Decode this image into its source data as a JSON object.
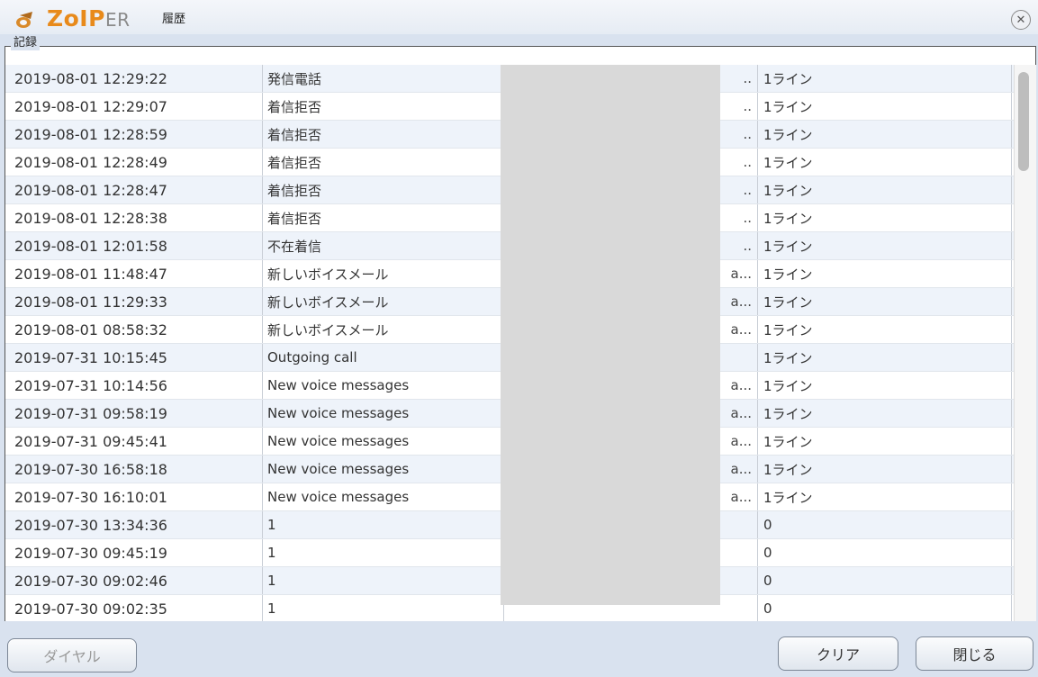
{
  "window": {
    "brand_main": "ZoIP",
    "brand_tail": "ER",
    "title": "履歴"
  },
  "group": {
    "label": "記録"
  },
  "rows": [
    {
      "time": "2019-08-01 12:29:22",
      "type": "発信電話",
      "num": "..",
      "line": "1ライン"
    },
    {
      "time": "2019-08-01 12:29:07",
      "type": "着信拒否",
      "num": "..",
      "line": "1ライン"
    },
    {
      "time": "2019-08-01 12:28:59",
      "type": "着信拒否",
      "num": "..",
      "line": "1ライン"
    },
    {
      "time": "2019-08-01 12:28:49",
      "type": "着信拒否",
      "num": "..",
      "line": "1ライン"
    },
    {
      "time": "2019-08-01 12:28:47",
      "type": "着信拒否",
      "num": "..",
      "line": "1ライン"
    },
    {
      "time": "2019-08-01 12:28:38",
      "type": "着信拒否",
      "num": "..",
      "line": "1ライン"
    },
    {
      "time": "2019-08-01 12:01:58",
      "type": "不在着信",
      "num": "..",
      "line": "1ライン"
    },
    {
      "time": "2019-08-01 11:48:47",
      "type": "新しいボイスメール",
      "num": "a...",
      "line": "1ライン"
    },
    {
      "time": "2019-08-01 11:29:33",
      "type": "新しいボイスメール",
      "num": "a...",
      "line": "1ライン"
    },
    {
      "time": "2019-08-01 08:58:32",
      "type": "新しいボイスメール",
      "num": "a...",
      "line": "1ライン"
    },
    {
      "time": "2019-07-31 10:15:45",
      "type": "Outgoing call",
      "num": "",
      "line": "1ライン"
    },
    {
      "time": "2019-07-31 10:14:56",
      "type": "New voice messages",
      "num": "a...",
      "line": "1ライン"
    },
    {
      "time": "2019-07-31 09:58:19",
      "type": "New voice messages",
      "num": "a...",
      "line": "1ライン"
    },
    {
      "time": "2019-07-31 09:45:41",
      "type": "New voice messages",
      "num": "a...",
      "line": "1ライン"
    },
    {
      "time": "2019-07-30 16:58:18",
      "type": "New voice messages",
      "num": "a...",
      "line": "1ライン"
    },
    {
      "time": "2019-07-30 16:10:01",
      "type": "New voice messages",
      "num": "a...",
      "line": "1ライン"
    },
    {
      "time": "2019-07-30 13:34:36",
      "type": "1",
      "num": "",
      "line": "0"
    },
    {
      "time": "2019-07-30 09:45:19",
      "type": "1",
      "num": "",
      "line": "0"
    },
    {
      "time": "2019-07-30 09:02:46",
      "type": "1",
      "num": "",
      "line": "0"
    },
    {
      "time": "2019-07-30 09:02:35",
      "type": "1",
      "num": "",
      "line": "0"
    }
  ],
  "buttons": {
    "dial": "ダイヤル",
    "clear": "クリア",
    "close": "閉じる"
  },
  "colors": {
    "brand_orange": "#e88a1b",
    "window_bg": "#d9e2ef",
    "row_alt": "#eef3fa"
  }
}
